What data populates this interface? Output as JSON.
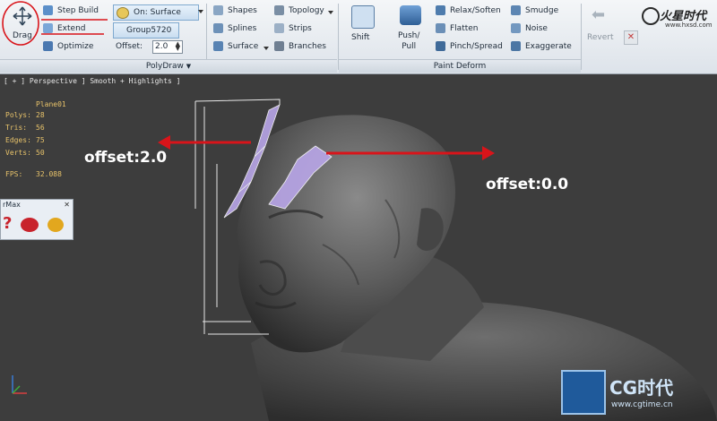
{
  "ribbon": {
    "polydraw": {
      "drag_label": "Drag",
      "step_build": "Step Build",
      "extend": "Extend",
      "optimize": "Optimize",
      "on_surface": "On: Surface",
      "group": "Group5720",
      "offset_label": "Offset:",
      "offset_value": "2.0",
      "shapes": "Shapes",
      "splines": "Splines",
      "surface": "Surface",
      "topology": "Topology",
      "strips": "Strips",
      "branches": "Branches",
      "group_title": "PolyDraw"
    },
    "paint_deform": {
      "shift": "Shift",
      "push_pull": "Push/\nPull",
      "relax_soften": "Relax/Soften",
      "flatten": "Flatten",
      "pinch_spread": "Pinch/Spread",
      "smudge": "Smudge",
      "noise": "Noise",
      "exaggerate": "Exaggerate",
      "revert": "Revert",
      "group_title": "Paint Deform"
    },
    "logo": "火星时代",
    "logo_url": "www.hxsd.com"
  },
  "viewport": {
    "label": "[ + ] Perspective ] Smooth + Highlights ]",
    "object_name": "Plane01",
    "stats": [
      {
        "k": "Polys:",
        "v": "28"
      },
      {
        "k": "Tris:",
        "v": "56"
      },
      {
        "k": "Edges:",
        "v": "75"
      },
      {
        "k": "Verts:",
        "v": "50"
      },
      {
        "k": "FPS:",
        "v": "32.088"
      }
    ],
    "callout_left": "offset:2.0",
    "callout_right": "offset:0.0",
    "mini_title": "rMax",
    "watermark": "CG时代",
    "watermark_url": "www.cgtime.cn"
  },
  "colors": {
    "annotation_red": "#d9141a",
    "selection_fill": "#b9a6e8",
    "stats_text": "#e8c36a"
  }
}
